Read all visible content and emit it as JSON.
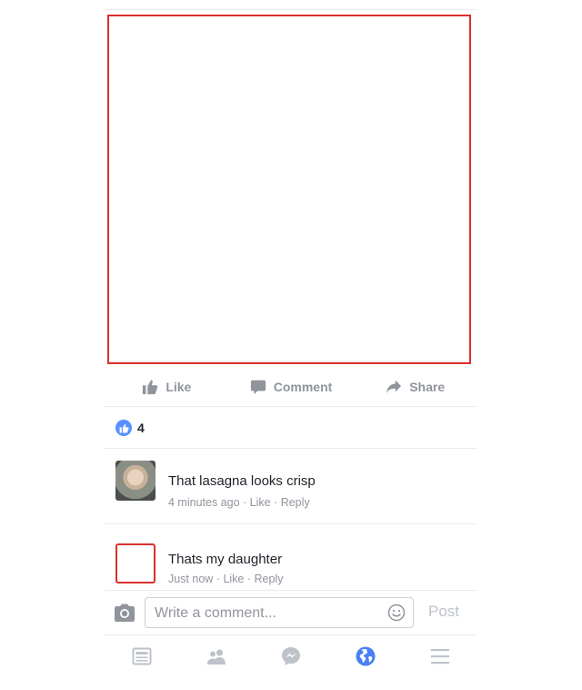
{
  "actions": {
    "like": "Like",
    "comment": "Comment",
    "share": "Share"
  },
  "reactions": {
    "count": "4"
  },
  "comments": [
    {
      "text": "That lasagna looks crisp",
      "time": "4 minutes ago",
      "like": "Like",
      "reply": "Reply",
      "separator": " · "
    },
    {
      "text": "Thats my daughter",
      "time": "Just now",
      "like": "Like",
      "reply": "Reply",
      "separator": " · "
    }
  ],
  "composer": {
    "placeholder": "Write a comment...",
    "post": "Post"
  },
  "tabs": [
    "news-feed",
    "friends",
    "messenger",
    "notifications",
    "more"
  ],
  "icons": {
    "like": "thumbs-up-icon",
    "comment": "speech-bubble-icon",
    "share": "share-arrow-icon",
    "camera": "camera-icon",
    "smiley": "smiley-icon"
  },
  "colors": {
    "accent": "#5890ff",
    "muted": "#90949c",
    "text": "#1d2129",
    "active_tab": "#4a80f5",
    "inactive_tab": "#bec3c9",
    "highlight_box": "#d9302c"
  }
}
